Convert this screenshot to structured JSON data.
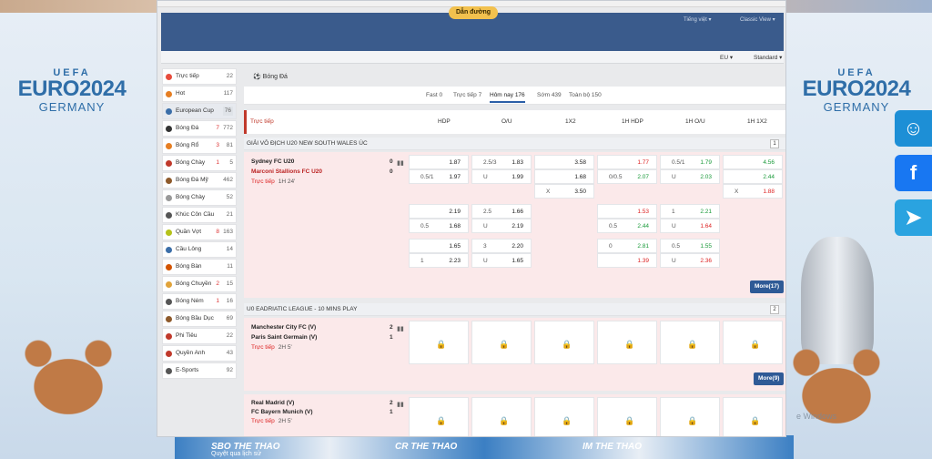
{
  "app": {
    "nav_button": "Dẫn đường",
    "language": "Tiếng việt ▾",
    "view_mode": "Classic View ▾",
    "odds_format": "EU ▾",
    "odds_type": "Standard ▾"
  },
  "euro_left": {
    "uefa": "UEFA",
    "title": "EURO2024",
    "country": "GERMANY"
  },
  "euro_right": {
    "uefa": "UEFA",
    "title": "EURO2024",
    "country": "GERMANY"
  },
  "footer": {
    "left": "SBO THE THAO",
    "caption": "Quyệt qua lịch sử",
    "mid": "CR THE THAO",
    "right": "IM THE THAO"
  },
  "watermark": "e Windows",
  "sidebar": [
    {
      "label": "Trực tiếp",
      "live": "",
      "count": "22",
      "icon": "live-icon",
      "color": "#e74c3c"
    },
    {
      "label": "Hot",
      "live": "",
      "count": "117",
      "icon": "fire-icon",
      "color": "#e67e22"
    },
    {
      "label": "European Cup",
      "live": "",
      "count": "76",
      "icon": "cup-icon",
      "color": "#3b6ea8"
    },
    {
      "label": "Bóng Đá",
      "live": "7",
      "count": "772",
      "icon": "soccer-icon",
      "color": "#333"
    },
    {
      "label": "Bóng Rổ",
      "live": "3",
      "count": "81",
      "icon": "basketball-icon",
      "color": "#e67e22"
    },
    {
      "label": "Bóng Chày",
      "live": "1",
      "count": "5",
      "icon": "baseball-icon",
      "color": "#c0392b"
    },
    {
      "label": "Bóng Đá Mỹ",
      "live": "",
      "count": "462",
      "icon": "american-football-icon",
      "color": "#8e5a2b"
    },
    {
      "label": "Bóng Chày",
      "live": "",
      "count": "52",
      "icon": "softball-icon",
      "color": "#999"
    },
    {
      "label": "Khúc Côn Cầu",
      "live": "",
      "count": "21",
      "icon": "hockey-icon",
      "color": "#555"
    },
    {
      "label": "Quần Vợt",
      "live": "8",
      "count": "163",
      "icon": "tennis-icon",
      "color": "#b5c21b"
    },
    {
      "label": "Cầu Lông",
      "live": "",
      "count": "14",
      "icon": "badminton-icon",
      "color": "#3b6ea8"
    },
    {
      "label": "Bóng Bàn",
      "live": "",
      "count": "11",
      "icon": "table-tennis-icon",
      "color": "#d35400"
    },
    {
      "label": "Bóng Chuyền",
      "live": "2",
      "count": "15",
      "icon": "volleyball-icon",
      "color": "#e1a33a"
    },
    {
      "label": "Bóng Ném",
      "live": "1",
      "count": "16",
      "icon": "handball-icon",
      "color": "#555"
    },
    {
      "label": "Bóng Bầu Dục",
      "live": "",
      "count": "69",
      "icon": "rugby-icon",
      "color": "#8e5a2b"
    },
    {
      "label": "Phi Tiêu",
      "live": "",
      "count": "22",
      "icon": "darts-icon",
      "color": "#c0392b"
    },
    {
      "label": "Quyền Anh",
      "live": "",
      "count": "43",
      "icon": "boxing-icon",
      "color": "#c0392b"
    },
    {
      "label": "E-Sports",
      "live": "",
      "count": "92",
      "icon": "esports-icon",
      "color": "#555"
    }
  ],
  "breadcrumb": "Bóng Đá",
  "tabs": [
    "Fast 0",
    "Trực tiếp 7",
    "Hôm nay 176",
    "Sớm 439",
    "Toàn bộ 150"
  ],
  "headers": {
    "live": "Trực tiếp",
    "hdp": "HDP",
    "ou": "O/U",
    "x12": "1X2",
    "h_hdp": "1H HDP",
    "h_ou": "1H O/U",
    "h_x12": "1H 1X2"
  },
  "leagues": [
    {
      "name": "GIẢI VÔ ĐỊCH U20 NEW SOUTH WALES ÚC",
      "count": "1"
    },
    {
      "name": "U0 EADRIATIC LEAGUE - 10 MINS PLAY",
      "count": "2"
    }
  ],
  "matches": [
    {
      "home": "Sydney FC U20",
      "away": "Marconi Stallions FC U20",
      "hs": "0",
      "as": "0",
      "status": "Trực tiếp",
      "time": "1H 24'",
      "more": "More(17)"
    },
    {
      "home": "Manchester City FC (V)",
      "away": "Paris Saint Germain (V)",
      "hs": "2",
      "as": "1",
      "status": "Trực tiếp",
      "time": "2H 5'",
      "more": "More(9)"
    },
    {
      "home": "Real Madrid (V)",
      "away": "FC Bayern Munich (V)",
      "hs": "2",
      "as": "1",
      "status": "Trực tiếp",
      "time": "2H 5'"
    }
  ],
  "odds": [
    [
      "",
      "1.87",
      "2.5/3",
      "1.83",
      "",
      "3.58",
      "",
      "1.77",
      "0.5/1",
      "1.79",
      "",
      "4.56"
    ],
    [
      "0.5/1",
      "1.97",
      "U",
      "1.99",
      "",
      "1.68",
      "0/0.5",
      "2.07",
      "U",
      "2.03",
      "",
      "2.44"
    ],
    [
      "",
      "",
      "",
      "",
      "X",
      "3.50",
      "",
      "",
      "",
      "",
      "X",
      "1.88"
    ],
    [
      "",
      "2.19",
      "2.5",
      "1.66",
      "",
      "",
      "",
      "1.53",
      "1",
      "2.21",
      "",
      ""
    ],
    [
      "0.5",
      "1.68",
      "U",
      "2.19",
      "",
      "",
      "0.5",
      "2.44",
      "U",
      "1.64",
      "",
      ""
    ],
    [
      "",
      "1.65",
      "3",
      "2.20",
      "",
      "",
      "0",
      "2.81",
      "0.5",
      "1.55",
      "",
      ""
    ],
    [
      "1",
      "2.23",
      "U",
      "1.65",
      "",
      "",
      "",
      "1.39",
      "U",
      "2.36",
      "",
      ""
    ]
  ],
  "colors": {
    "accent": "#3a5b8c",
    "live": "#d22",
    "up": "#1a9a3a",
    "down": "#d22"
  }
}
